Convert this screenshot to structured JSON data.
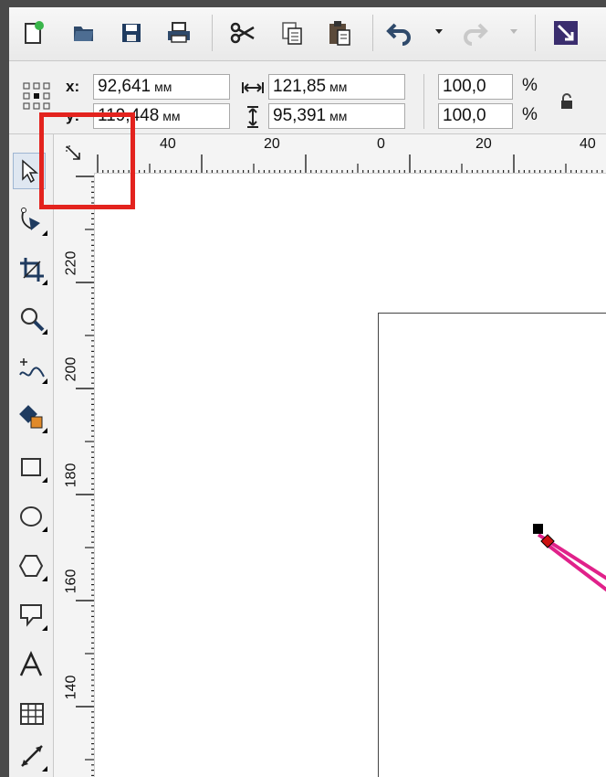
{
  "propertybar": {
    "x_label": "x:",
    "x_value": "92,641",
    "y_label": "y:",
    "y_value": "119,448",
    "width_value": "121,85",
    "height_value": "95,391",
    "unit": "мм",
    "scale_x": "100,0",
    "scale_y": "100,0",
    "percent": "%"
  },
  "ruler": {
    "h_labels": [
      "40",
      "20",
      "0",
      "20",
      "40"
    ],
    "v_labels": [
      "220",
      "200",
      "180",
      "160",
      "140"
    ]
  },
  "colors": {
    "highlight": "#e3231e",
    "curve": "#e0218a",
    "node": "#cc1111"
  },
  "icons": {
    "toolbar": [
      "new-document-icon",
      "open-folder-icon",
      "save-icon",
      "print-icon",
      "cut-icon",
      "copy-icon",
      "paste-icon",
      "undo-icon",
      "redo-icon",
      "import-icon"
    ],
    "toolbox": [
      "pick-tool-icon",
      "shape-tool-icon",
      "crop-tool-icon",
      "zoom-tool-icon",
      "freehand-tool-icon",
      "smart-fill-icon",
      "rectangle-tool-icon",
      "ellipse-tool-icon",
      "polygon-tool-icon",
      "callout-shape-icon",
      "text-tool-icon",
      "table-tool-icon",
      "dimension-tool-icon"
    ]
  }
}
